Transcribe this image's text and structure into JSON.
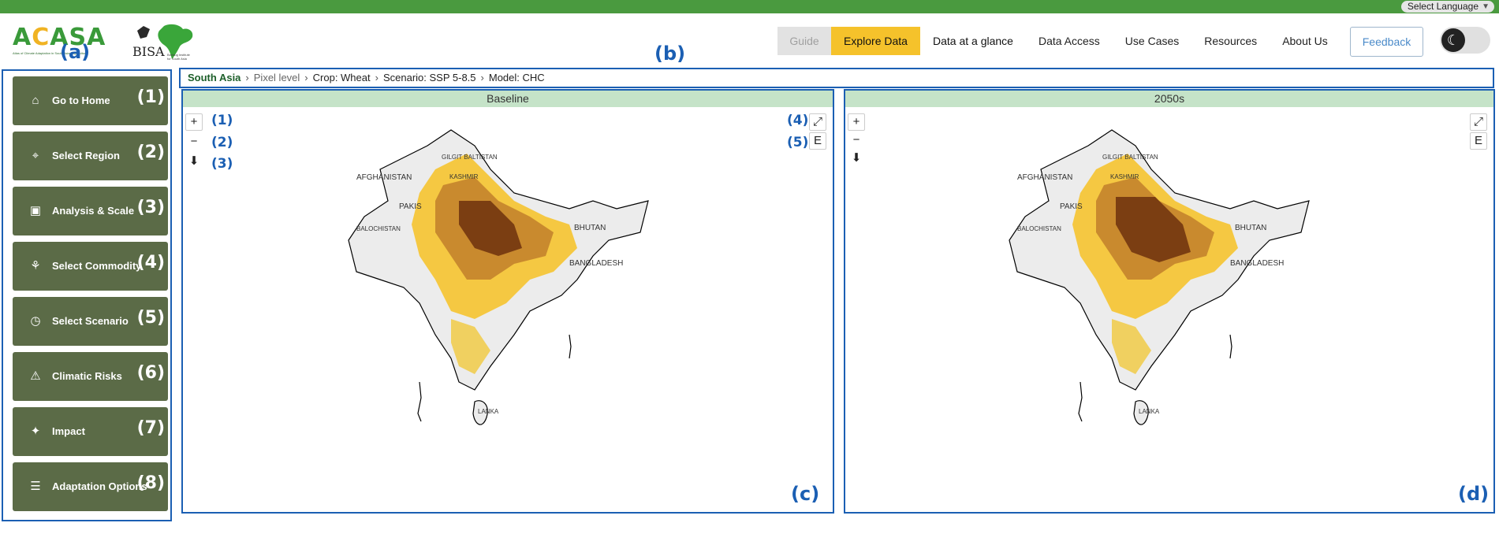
{
  "top_bar": {
    "language_label": "Select Language"
  },
  "header": {
    "logo_text": "ACASA",
    "logo_tagline": "Atlas of Climate Adaptation in South Asian Agriculture",
    "partner_logo_text": "BISA",
    "partner_tagline": "Borlaug Institute for South Asia",
    "nav": [
      "Guide",
      "Explore Data",
      "Data at a glance",
      "Data Access",
      "Use Cases",
      "Resources",
      "About Us"
    ],
    "feedback_label": "Feedback"
  },
  "annotations": {
    "a": "(a)",
    "b": "(b)",
    "c": "(c)",
    "d": "(d)",
    "ctl1": "(1)",
    "ctl2": "(2)",
    "ctl3": "(3)",
    "ctl4": "(4)",
    "ctl5": "(5)"
  },
  "sidebar": {
    "items": [
      {
        "label": "Go to Home",
        "icon": "home-icon",
        "num": "(1)"
      },
      {
        "label": "Select Region",
        "icon": "map-pin-icon",
        "num": "(2)"
      },
      {
        "label": "Analysis & Scale",
        "icon": "analysis-icon",
        "num": "(3)"
      },
      {
        "label": "Select Commodity",
        "icon": "crop-icon",
        "num": "(4)"
      },
      {
        "label": "Select Scenario",
        "icon": "clock-icon",
        "num": "(5)"
      },
      {
        "label": "Climatic Risks",
        "icon": "warning-icon",
        "num": "(6)"
      },
      {
        "label": "Impact",
        "icon": "sparkle-icon",
        "num": "(7)"
      },
      {
        "label": "Adaptation Options",
        "icon": "sliders-icon",
        "num": "(8)"
      }
    ]
  },
  "breadcrumb": {
    "region": "South Asia",
    "level": "Pixel level",
    "crop": "Crop: Wheat",
    "scenario": "Scenario: SSP 5-8.5",
    "model": "Model: CHC"
  },
  "panels": {
    "left_title": "Baseline",
    "right_title": "2050s",
    "map_labels": [
      "AFGHANISTAN",
      "GILGIT BALTISTAN",
      "KASHMIR",
      "PAKIS",
      "BALOCHISTAN",
      "BHUTAN",
      "BANGLADESH",
      "LANKA"
    ]
  },
  "controls": {
    "zoom_in": "+",
    "zoom_out": "−",
    "download": "⬇",
    "fullscreen": "⤢",
    "export": "E"
  },
  "colors": {
    "accent": "#f5c22b",
    "sidebar_button": "#5b6b47",
    "annotation": "#1b5fb3",
    "panel_title_bg": "#c5e3c8",
    "top_strip": "#4a9a3f"
  }
}
